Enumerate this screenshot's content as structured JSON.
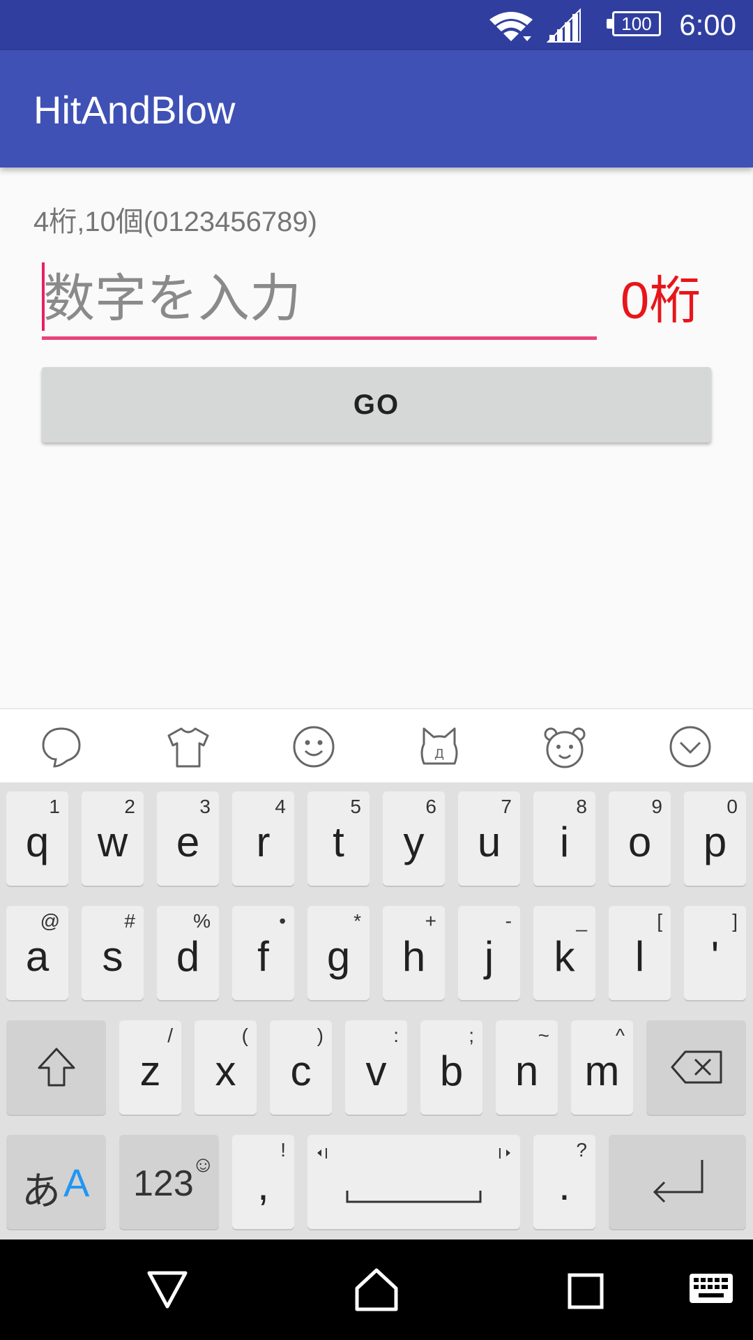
{
  "status_bar": {
    "time": "6:00",
    "battery": "100"
  },
  "app_bar": {
    "title": "HitAndBlow"
  },
  "content": {
    "hint": "4桁,10個(0123456789)",
    "input_placeholder": "数字を入力",
    "input_value": "",
    "digit_count": "0桁",
    "go_label": "GO"
  },
  "keyboard_toolbar": {
    "icons": [
      "speech-bubble-icon",
      "shirt-icon",
      "smiley-icon",
      "cat-face-icon",
      "bear-face-icon",
      "collapse-keyboard-icon"
    ]
  },
  "keyboard": {
    "row1": [
      {
        "main": "q",
        "sub": "1"
      },
      {
        "main": "w",
        "sub": "2"
      },
      {
        "main": "e",
        "sub": "3"
      },
      {
        "main": "r",
        "sub": "4"
      },
      {
        "main": "t",
        "sub": "5"
      },
      {
        "main": "y",
        "sub": "6"
      },
      {
        "main": "u",
        "sub": "7"
      },
      {
        "main": "i",
        "sub": "8"
      },
      {
        "main": "o",
        "sub": "9"
      },
      {
        "main": "p",
        "sub": "0"
      }
    ],
    "row2": [
      {
        "main": "a",
        "sub": "@"
      },
      {
        "main": "s",
        "sub": "#"
      },
      {
        "main": "d",
        "sub": "%"
      },
      {
        "main": "f",
        "sub": "•"
      },
      {
        "main": "g",
        "sub": "*"
      },
      {
        "main": "h",
        "sub": "+"
      },
      {
        "main": "j",
        "sub": "-"
      },
      {
        "main": "k",
        "sub": "_"
      },
      {
        "main": "l",
        "sub": "["
      },
      {
        "main": "'",
        "sub": "]"
      }
    ],
    "row3": [
      {
        "main": "z",
        "sub": "/"
      },
      {
        "main": "x",
        "sub": "("
      },
      {
        "main": "c",
        "sub": ")"
      },
      {
        "main": "v",
        "sub": ":"
      },
      {
        "main": "b",
        "sub": ";"
      },
      {
        "main": "n",
        "sub": "~"
      },
      {
        "main": "m",
        "sub": "^"
      }
    ],
    "row4": {
      "mode_kana": "あ",
      "mode_alpha": "A",
      "numbers": "123",
      "numbers_emoji": "☺",
      "comma": ",",
      "comma_sub": "!",
      "period": ".",
      "period_sub": "?"
    }
  },
  "colors": {
    "status_bar": "#303f9f",
    "app_bar": "#3f51b5",
    "accent": "#e91e63",
    "digit_count": "#e8151a",
    "mode_alpha": "#2196f3"
  }
}
